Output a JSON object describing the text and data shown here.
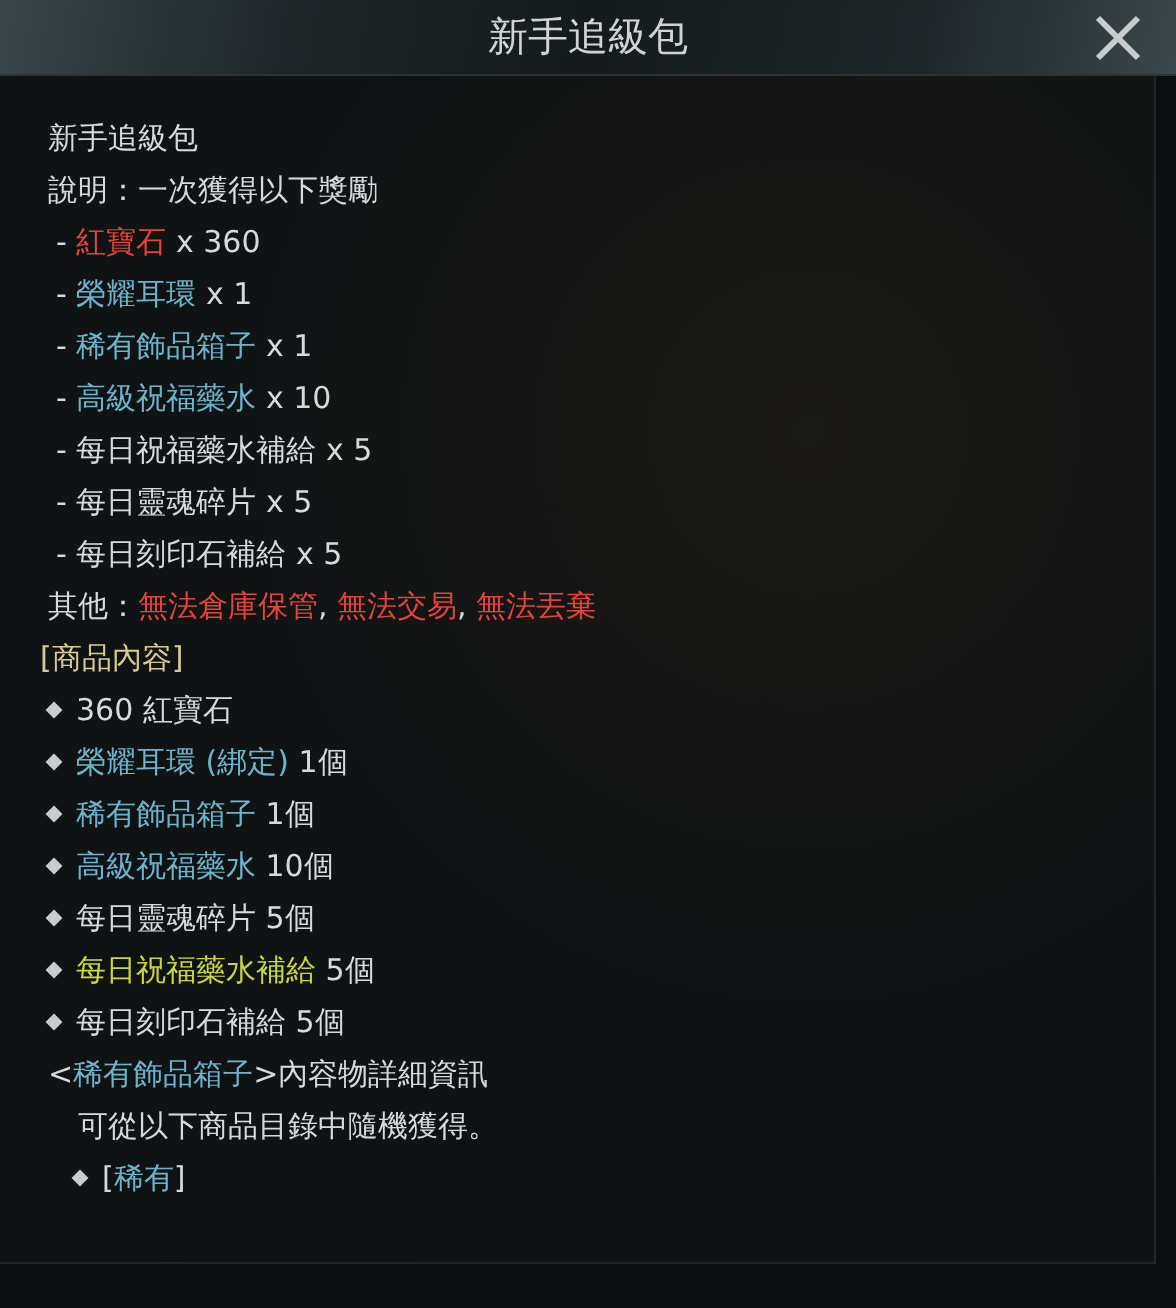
{
  "window": {
    "title": "新手追級包"
  },
  "lines": [
    {
      "kind": "text",
      "segments": [
        {
          "text": "新手追級包",
          "color": "#d6dadb"
        }
      ]
    },
    {
      "kind": "text",
      "segments": [
        {
          "text": "說明：一次獲得以下獎勵",
          "color": "#d6dadb"
        }
      ]
    },
    {
      "kind": "dash",
      "segments": [
        {
          "text": "- ",
          "color": "#d6dadb"
        },
        {
          "text": "紅寶石",
          "color": "#e2443c"
        },
        {
          "text": " x 360",
          "color": "#d6dadb"
        }
      ]
    },
    {
      "kind": "dash",
      "segments": [
        {
          "text": "- ",
          "color": "#d6dadb"
        },
        {
          "text": "榮耀耳環",
          "color": "#6cb4cc"
        },
        {
          "text": " x 1",
          "color": "#d6dadb"
        }
      ]
    },
    {
      "kind": "dash",
      "segments": [
        {
          "text": "- ",
          "color": "#d6dadb"
        },
        {
          "text": "稀有飾品箱子",
          "color": "#6cb4cc"
        },
        {
          "text": " x 1",
          "color": "#d6dadb"
        }
      ]
    },
    {
      "kind": "dash",
      "segments": [
        {
          "text": "- ",
          "color": "#d6dadb"
        },
        {
          "text": "高級祝福藥水",
          "color": "#6cb4cc"
        },
        {
          "text": " x 10",
          "color": "#d6dadb"
        }
      ]
    },
    {
      "kind": "dash",
      "segments": [
        {
          "text": "- 每日祝福藥水補給 x 5",
          "color": "#d6dadb"
        }
      ]
    },
    {
      "kind": "dash",
      "segments": [
        {
          "text": "- 每日靈魂碎片 x 5",
          "color": "#d6dadb"
        }
      ]
    },
    {
      "kind": "dash",
      "segments": [
        {
          "text": "- 每日刻印石補給 x 5",
          "color": "#d6dadb"
        }
      ]
    },
    {
      "kind": "text",
      "segments": [
        {
          "text": "其他：",
          "color": "#d6dadb"
        },
        {
          "text": "無法倉庫保管",
          "color": "#e2443c",
          "suffix": ", "
        },
        {
          "text": "無法交易",
          "color": "#e2443c",
          "suffix": ", "
        },
        {
          "text": "無法丟棄",
          "color": "#e2443c"
        }
      ]
    },
    {
      "kind": "heading",
      "segments": [
        {
          "text": "[商品內容]",
          "color": "#d8c994"
        }
      ]
    },
    {
      "kind": "bullet",
      "segments": [
        {
          "text": "360 紅寶石",
          "color": "#d6dadb"
        }
      ]
    },
    {
      "kind": "bullet",
      "segments": [
        {
          "text": "榮耀耳環 (綁定)",
          "color": "#6cb4cc"
        },
        {
          "text": " 1個",
          "color": "#d6dadb"
        }
      ]
    },
    {
      "kind": "bullet",
      "segments": [
        {
          "text": "稀有飾品箱子",
          "color": "#6cb4cc"
        },
        {
          "text": " 1個",
          "color": "#d6dadb"
        }
      ]
    },
    {
      "kind": "bullet",
      "segments": [
        {
          "text": "高級祝福藥水",
          "color": "#6cb4cc"
        },
        {
          "text": " 10個",
          "color": "#d6dadb"
        }
      ]
    },
    {
      "kind": "bullet",
      "segments": [
        {
          "text": "每日靈魂碎片 5個",
          "color": "#d6dadb"
        }
      ]
    },
    {
      "kind": "bullet",
      "segments": [
        {
          "text": "每日祝福藥水補給",
          "color": "#c9d63e"
        },
        {
          "text": " 5個",
          "color": "#d6dadb"
        }
      ]
    },
    {
      "kind": "bullet",
      "segments": [
        {
          "text": "每日刻印石補給 5個",
          "color": "#d6dadb"
        }
      ]
    },
    {
      "kind": "text",
      "segments": [
        {
          "text": "<",
          "color": "#d6dadb"
        },
        {
          "text": "稀有飾品箱子",
          "color": "#6cb4cc"
        },
        {
          "text": ">內容物詳細資訊",
          "color": "#d6dadb"
        }
      ]
    },
    {
      "kind": "indent",
      "segments": [
        {
          "text": "可從以下商品目錄中隨機獲得。",
          "color": "#d6dadb"
        }
      ]
    },
    {
      "kind": "sub-bullet",
      "segments": [
        {
          "text": "[",
          "color": "#d6dadb"
        },
        {
          "text": "稀有",
          "color": "#6cb4cc"
        },
        {
          "text": "]",
          "color": "#d6dadb"
        }
      ]
    }
  ]
}
